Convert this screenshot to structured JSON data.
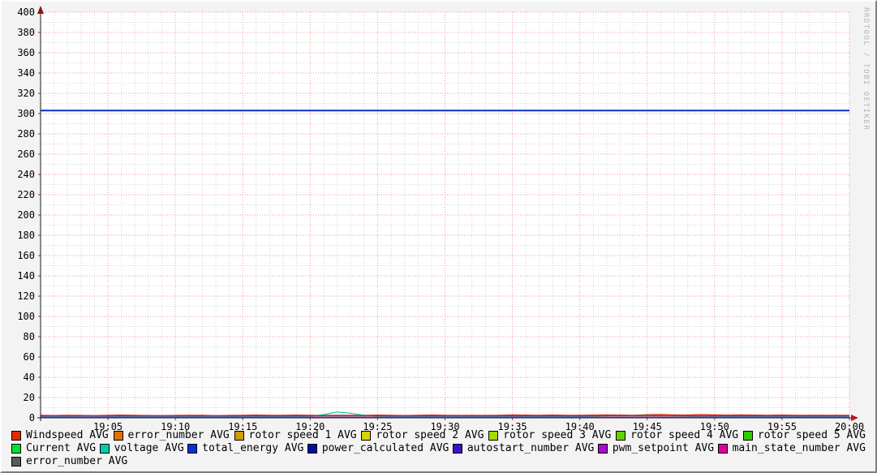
{
  "watermark": "RRDTOOL / TOBI OETIKER",
  "style": {
    "outer_bg": "#f3f3f3",
    "plot_bg": "#ffffff",
    "minor_grid": "#d6d6d6",
    "major_grid": "#f29a9a",
    "axis_color": "#1a1a1a",
    "y_arrow_color": "#8f1515",
    "x_arrow_color": "#c41414"
  },
  "chart_data": {
    "type": "line",
    "title": "",
    "xlabel": "",
    "ylabel": "",
    "x_start": "19:00",
    "x_end": "20:00",
    "x_minutes_range": [
      0,
      60
    ],
    "x_major_step_min": 5,
    "x_minor_step_min": 1,
    "x_tick_labels": [
      "19:05",
      "19:10",
      "19:15",
      "19:20",
      "19:25",
      "19:30",
      "19:35",
      "19:40",
      "19:45",
      "19:50",
      "19:55",
      "20:00"
    ],
    "ylim": [
      0,
      400
    ],
    "y_major_step": 20,
    "y_minor_step": 10,
    "y_tick_labels": [
      "0",
      "20",
      "40",
      "60",
      "80",
      "100",
      "120",
      "140",
      "160",
      "180",
      "200",
      "220",
      "240",
      "260",
      "280",
      "300",
      "320",
      "340",
      "360",
      "380",
      "400"
    ],
    "grid": true,
    "legend_position": "bottom",
    "series": [
      {
        "name": "Windspeed AVG",
        "color": "#e22c00",
        "width": 1.2,
        "values": [
          2.5,
          2.3,
          2.6,
          2.4,
          2.2,
          2.5,
          2.7,
          2.5,
          2.3,
          2.1,
          2.4,
          2.6,
          2.5,
          2.2,
          2.4,
          2.6,
          2.8,
          2.6,
          2.5,
          2.7,
          2.6,
          2.4,
          2.5,
          2.6,
          2.5,
          2.7,
          2.5,
          2.3,
          2.5,
          2.8,
          2.6,
          2.4,
          2.5,
          2.4,
          2.6,
          2.9,
          2.7,
          2.5,
          2.8,
          2.6,
          2.5,
          2.7,
          3.0,
          2.8,
          2.6,
          3.1,
          3.3,
          3.0,
          2.8,
          3.2,
          2.9,
          2.7,
          2.9,
          2.7,
          2.6,
          2.8,
          2.6,
          2.5,
          2.6,
          2.5,
          2.5
        ]
      },
      {
        "name": "error_number AVG",
        "color": "#e07000",
        "width": 1,
        "constant": 0.6
      },
      {
        "name": "rotor speed 1 AVG",
        "color": "#cf9c00",
        "width": 1,
        "constant": 0.1
      },
      {
        "name": "rotor speed 2 AVG",
        "color": "#d4d400",
        "width": 1,
        "constant": 0.1
      },
      {
        "name": "rotor speed 3 AVG",
        "color": "#a6d800",
        "width": 1,
        "constant": 0.1
      },
      {
        "name": "rotor speed 4 AVG",
        "color": "#62d200",
        "width": 1,
        "constant": 0.1
      },
      {
        "name": "rotor speed 5 AVG",
        "color": "#2ecc00",
        "width": 1,
        "constant": 0.1
      },
      {
        "name": "Current AVG",
        "color": "#00df33",
        "width": 1,
        "constant": 0.7
      },
      {
        "name": "voltage AVG",
        "color": "#00ccaa",
        "width": 1.2,
        "values": [
          1.2,
          1.1,
          1.2,
          1.0,
          1.1,
          1.2,
          1.1,
          1.3,
          1.2,
          1.1,
          1.3,
          1.2,
          1.1,
          1.2,
          1.1,
          1.2,
          1.3,
          1.2,
          1.1,
          1.2,
          1.6,
          3.2,
          5.8,
          4.6,
          2.6,
          1.7,
          1.4,
          1.2,
          1.3,
          1.2,
          1.1,
          1.2,
          1.3,
          1.2,
          1.1,
          1.2,
          1.3,
          1.2,
          1.1,
          1.2,
          1.3,
          1.6,
          2.1,
          2.3,
          2.2,
          2.4,
          2.2,
          2.0,
          1.8,
          1.6,
          1.4,
          1.3,
          1.2,
          1.3,
          1.2,
          1.1,
          1.2,
          1.3,
          1.2,
          1.1,
          1.2
        ]
      },
      {
        "name": "total_energy AVG",
        "color": "#0a2fd0",
        "width": 2,
        "constant": 303
      },
      {
        "name": "power_calculated AVG",
        "color": "#000f9e",
        "width": 1,
        "constant": 0.15
      },
      {
        "name": "autostart_number AVG",
        "color": "#3a10c8",
        "width": 1,
        "constant": 0.5
      },
      {
        "name": "pwm_setpoint AVG",
        "color": "#a80ccc",
        "width": 1,
        "constant": 0.25
      },
      {
        "name": "main_state_number AVG",
        "color": "#e0009e",
        "width": 1.4,
        "constant": 2.0
      },
      {
        "name": "error_number AVG",
        "color": "#5a5a5a",
        "width": 1,
        "constant": 0.4
      }
    ]
  },
  "legend": {
    "rows": [
      [
        {
          "label": "Windspeed AVG",
          "color": "#e22c00"
        },
        {
          "label": "error_number AVG",
          "color": "#e07000"
        },
        {
          "label": "rotor speed 1 AVG",
          "color": "#cf9c00"
        },
        {
          "label": "rotor speed 2 AVG",
          "color": "#d4d400"
        },
        {
          "label": "rotor speed 3 AVG",
          "color": "#a6d800"
        },
        {
          "label": "rotor speed 4 AVG",
          "color": "#62d200"
        },
        {
          "label": "rotor speed 5 AVG",
          "color": "#2ecc00"
        }
      ],
      [
        {
          "label": "Current AVG",
          "color": "#00df33"
        },
        {
          "label": "voltage AVG",
          "color": "#00ccaa"
        },
        {
          "label": "total_energy AVG",
          "color": "#0a2fd0"
        },
        {
          "label": "power_calculated AVG",
          "color": "#000f9e"
        },
        {
          "label": "autostart_number AVG",
          "color": "#3a10c8"
        },
        {
          "label": "pwm_setpoint AVG",
          "color": "#a80ccc"
        },
        {
          "label": "main_state_number AVG",
          "color": "#e0009e"
        }
      ],
      [
        {
          "label": "error_number AVG",
          "color": "#5a5a5a"
        }
      ]
    ]
  }
}
